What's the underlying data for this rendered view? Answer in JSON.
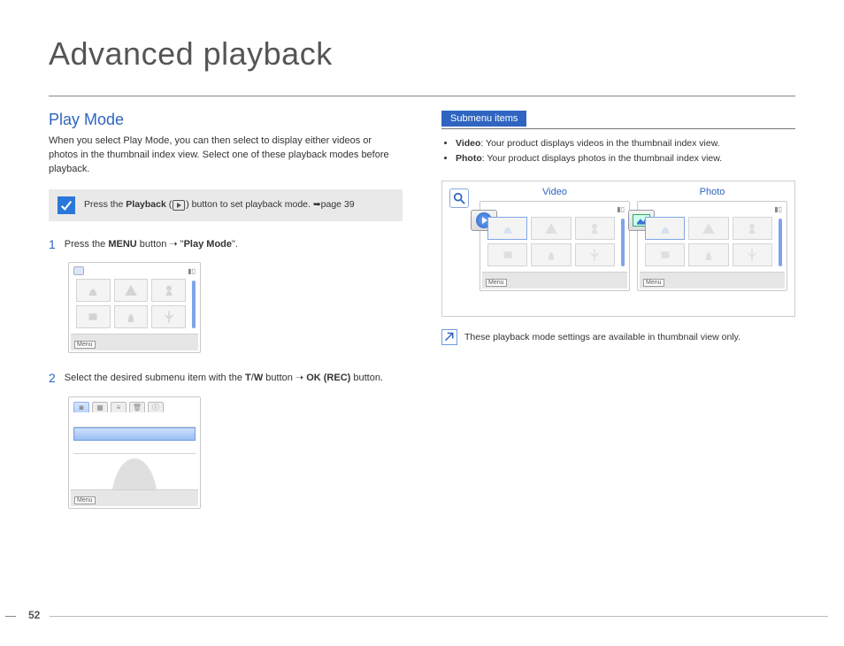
{
  "page_title": "Advanced playback",
  "page_number": "52",
  "left": {
    "section_title": "Play Mode",
    "intro": "When you select Play Mode, you can then select to display either videos or photos in the thumbnail index view. Select one of these playback modes before playback.",
    "tip_prefix": "Press the ",
    "tip_bold1": "Playback",
    "tip_mid": " (",
    "tip_close": ") button to set playback mode. ",
    "tip_pageref": "➥page 39",
    "step1_num": "1",
    "step1_a": "Press the ",
    "step1_b": "MENU",
    "step1_c": " button ➝ \"",
    "step1_d": "Play Mode",
    "step1_e": "\".",
    "step2_num": "2",
    "step2_a": "Select the desired submenu item with the ",
    "step2_b": "T",
    "step2_c": "/",
    "step2_d": "W",
    "step2_e": " button ➝ ",
    "step2_f": "OK (REC)",
    "step2_g": " button.",
    "menu_chip": "Menu"
  },
  "right": {
    "submenu_header": "Submenu items",
    "bullet_video_b": "Video",
    "bullet_video_t": ": Your product displays videos in the thumbnail index view.",
    "bullet_photo_b": "Photo",
    "bullet_photo_t": ": Your product displays photos in the thumbnail index view.",
    "label_video": "Video",
    "label_photo": "Photo",
    "note": "These playback mode settings are available in thumbnail view only."
  }
}
